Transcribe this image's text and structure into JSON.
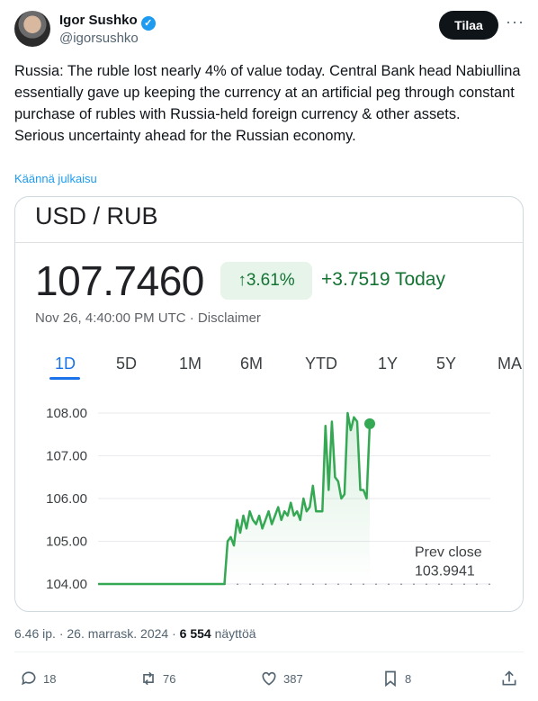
{
  "author": {
    "name": "Igor Sushko",
    "handle": "@igorsushko",
    "follow_label": "Tilaa"
  },
  "tweet": {
    "lines": [
      "Russia: The ruble lost nearly 4% of value today. Central Bank head Nabiullina essentially gave up keeping the currency at an artificial peg through constant purchase of rubles with Russia-held foreign currency & other assets.",
      "Serious uncertainty ahead for the Russian economy."
    ],
    "translate_label": "Käännä julkaisu"
  },
  "card": {
    "pair": "USD / RUB",
    "price": "107.7460",
    "change_pct": "↑3.61%",
    "change_abs": "+3.7519 Today",
    "timestamp": "Nov 26, 4:40:00 PM UTC · Disclaimer",
    "tabs": [
      "1D",
      "5D",
      "1M",
      "6M",
      "YTD",
      "1Y",
      "5Y",
      "MA"
    ],
    "active_tab": "1D",
    "accent_color": "#1a73e8",
    "positive_color": "#137333",
    "line_color": "#34a853"
  },
  "chart_data": {
    "type": "line",
    "ylim": [
      104.0,
      108.0
    ],
    "y_ticks": [
      "108.00",
      "107.00",
      "106.00",
      "105.00",
      "104.00"
    ],
    "prev_close_label": "Prev close",
    "prev_close_value": "103.9941",
    "series": [
      {
        "values": [
          104.0,
          104.0,
          104.0,
          104.0,
          104.0,
          104.0,
          104.0,
          104.0,
          104.0,
          104.0,
          104.0,
          104.0,
          104.0,
          104.0,
          104.0,
          104.0,
          104.0,
          104.0,
          104.0,
          104.0,
          104.0,
          104.0,
          104.0,
          104.0,
          104.0,
          104.0,
          104.0,
          104.0,
          104.0,
          104.0,
          104.0,
          104.0,
          104.0,
          104.0,
          104.0,
          104.0,
          104.0,
          104.0,
          104.0,
          104.0,
          104.0,
          105.0,
          105.1,
          104.9,
          105.5,
          105.2,
          105.6,
          105.3,
          105.7,
          105.5,
          105.4,
          105.6,
          105.3,
          105.5,
          105.7,
          105.4,
          105.6,
          105.8,
          105.5,
          105.7,
          105.6,
          105.9,
          105.6,
          105.7,
          105.5,
          106.0,
          105.7,
          105.8,
          106.3,
          105.7,
          105.7,
          105.7,
          107.7,
          106.2,
          107.8,
          106.5,
          106.4,
          106.0,
          106.1,
          108.0,
          107.6,
          107.9,
          107.8,
          106.2,
          106.2,
          106.0,
          107.75
        ]
      }
    ],
    "x_labels": [],
    "grid": true
  },
  "meta": {
    "time": "6.46 ip. · 26. marrask. 2024 ·",
    "views_count": "6 554",
    "views_label": "näyttöä"
  },
  "actions": {
    "replies": "18",
    "reposts": "76",
    "likes": "387",
    "bookmarks": "8"
  }
}
